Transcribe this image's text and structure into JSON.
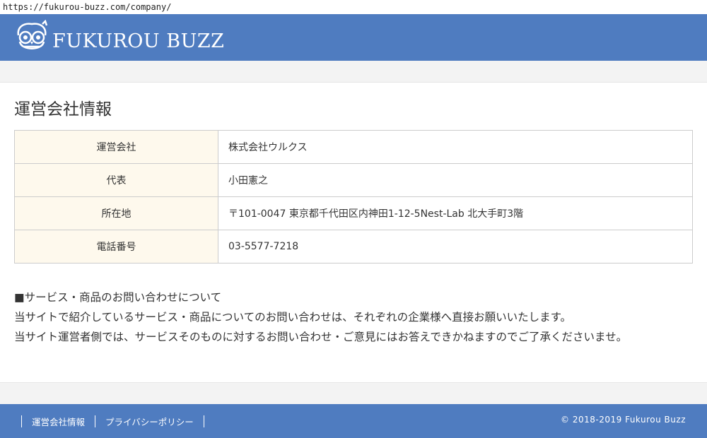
{
  "browser": {
    "url": "https://fukurou-buzz.com/company/"
  },
  "header": {
    "logo_text": "FUKUROU BUZZ"
  },
  "main": {
    "title": "運営会社情報",
    "rows": [
      {
        "label": "運営会社",
        "value": "株式会社ウルクス"
      },
      {
        "label": "代表",
        "value": "小田憲之"
      },
      {
        "label": "所在地",
        "value": "〒101-0047 東京都千代田区内神田1-12-5Nest-Lab 北大手町3階"
      },
      {
        "label": "電話番号",
        "value": "03-5577-7218"
      }
    ],
    "notice": {
      "heading": "■サービス・商品のお問い合わせについて",
      "line1": "当サイトで紹介しているサービス・商品についてのお問い合わせは、それぞれの企業様へ直接お願いいたします。",
      "line2": "当サイト運営者側では、サービスそのものに対するお問い合わせ・ご意見にはお答えできかねますのでご了承くださいませ。"
    }
  },
  "footer": {
    "links": [
      "運営会社情報",
      "プライバシーポリシー"
    ],
    "copyright": "© 2018-2019  Fukurou Buzz"
  },
  "colors": {
    "header_bg": "#4f7cc0",
    "table_label_bg": "#fef9ed",
    "page_bg": "#f3f3f3"
  },
  "icons": {
    "logo": "owl-logo-icon"
  }
}
